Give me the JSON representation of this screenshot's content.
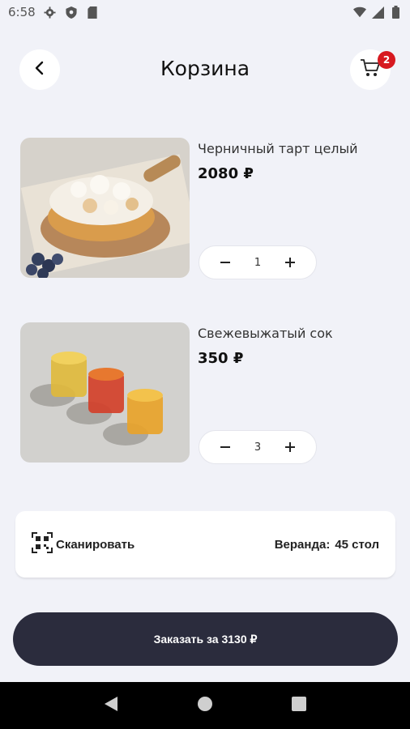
{
  "status_bar": {
    "time": "6:58"
  },
  "header": {
    "title": "Корзина",
    "cart_count": "2"
  },
  "items": [
    {
      "name": "Черничный тарт целый",
      "price": "2080 ₽",
      "quantity": "1"
    },
    {
      "name": "Свежевыжатый сок",
      "price": "350 ₽",
      "quantity": "3"
    }
  ],
  "scan": {
    "label": "Сканировать",
    "table_label": "Веранда:",
    "table_number": "45 стол"
  },
  "order": {
    "label": "Заказать за 3130 ₽"
  },
  "colors": {
    "background": "#f1f2f8",
    "button_dark": "#2b2c3d",
    "badge": "#d71920"
  }
}
